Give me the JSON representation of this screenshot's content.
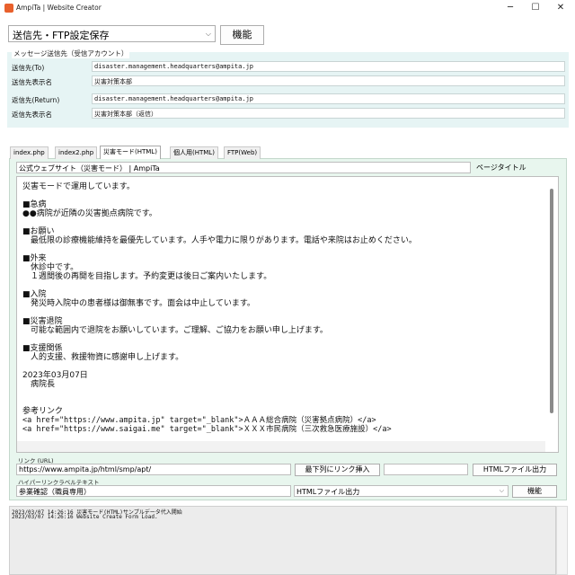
{
  "window": {
    "title": "AmpiTa | Website Creator",
    "minimize": "─",
    "maximize": "☐",
    "close": "✕"
  },
  "toolbar": {
    "selected": "送信先・FTP設定保存",
    "function_label": "機能"
  },
  "message_panel": {
    "caption": "メッセージ送信先（受信アカウント）",
    "rows": [
      {
        "label": "送信先(To)",
        "value": "disaster.management.headquarters@ampita.jp"
      },
      {
        "label": "送信先表示名",
        "value": "災害対策本部"
      },
      {
        "label": "返信先(Return)",
        "value": "disaster.management.headquarters@ampita.jp"
      },
      {
        "label": "返信先表示名",
        "value": "災害対策本部（返信）"
      }
    ]
  },
  "tabs": [
    {
      "label": "index.php"
    },
    {
      "label": "index2.php"
    },
    {
      "label": "災害モード(HTML)"
    },
    {
      "label": "個人用(HTML)"
    },
    {
      "label": "FTP(Web)"
    }
  ],
  "page_title": {
    "value": "公式ウェブサイト（災害モード） | AmpiTa",
    "label": "ページタイトル"
  },
  "editor_lines": [
    "災害モードで運用しています。",
    "",
    "■急病",
    "●●病院が近隣の災害拠点病院です。",
    "",
    "■お願い",
    "　最低限の診療機能維持を最優先しています。人手や電力に限りがあります。電話や来院はお止めください。",
    "",
    "■外来",
    "　休診中です。",
    "　１週間後の再開を目指します。予約変更は後日ご案内いたします。",
    "",
    "■入院",
    "　発災時入院中の患者様は御無事です。面会は中止しています。",
    "",
    "■災害退院",
    "　可能な範囲内で退院をお願いしています。ご理解、ご協力をお願い申し上げます。",
    "",
    "■支援関係",
    "　人的支援、救援物資に感謝申し上げます。",
    "",
    "2023年03月07日",
    "　病院長",
    "",
    "",
    "参考リンク",
    "<a href=\"https://www.ampita.jp\" target=\"_blank\">ＡＡＡ総合病院（災害拠点病院）</a>",
    "<a href=\"https://www.saigai.me\" target=\"_blank\">ＸＸＸ市民病院（三次救急医療施設）</a>"
  ],
  "link": {
    "label": "リンク (URL)",
    "url": "https://www.ampita.jp/html/smp/apt/",
    "insert_button": "最下列にリンク挿入",
    "extra_value": "",
    "html_output_button": "HTMLファイル出力"
  },
  "hyperlink": {
    "label": "ハイパーリンクラベルテキスト",
    "value": "参業確認（職員専用）",
    "dropdown_value": "HTMLファイル出力",
    "function_button": "機能"
  },
  "log": [
    "2023/03/07 14:26:16 災害モード(HTML)サンプルデータ代入開始",
    "2023/03/07 14:26:16 Website Create Form Load."
  ]
}
